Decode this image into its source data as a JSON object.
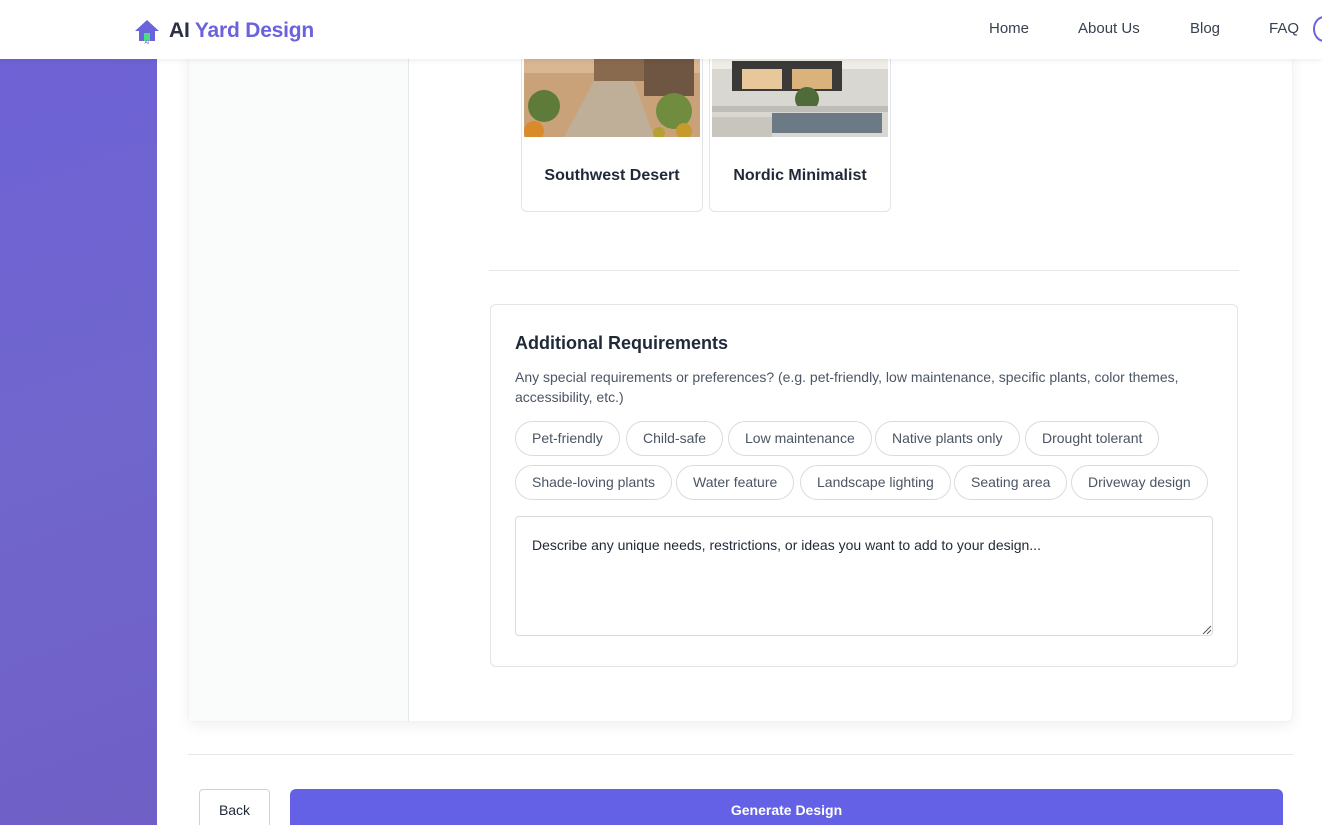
{
  "header": {
    "logo_ai": "AI",
    "logo_rest": "Yard Design",
    "nav": {
      "home": "Home",
      "about": "About Us",
      "blog": "Blog",
      "faq": "FAQ"
    }
  },
  "styles": [
    {
      "label": "Southwest Desert"
    },
    {
      "label": "Nordic Minimalist"
    }
  ],
  "requirements": {
    "title": "Additional Requirements",
    "description": "Any special requirements or preferences? (e.g. pet-friendly, low maintenance, specific plants, color themes, accessibility, etc.)",
    "chips": [
      "Pet-friendly",
      "Child-safe",
      "Low maintenance",
      "Native plants only",
      "Drought tolerant",
      "Shade-loving plants",
      "Water feature",
      "Landscape lighting",
      "Seating area",
      "Driveway design"
    ],
    "textarea_placeholder": "Describe any unique needs, restrictions, or ideas you want to add to your design..."
  },
  "actions": {
    "back": "Back",
    "generate": "Generate Design"
  },
  "colors": {
    "accent": "#6461e6",
    "brand": "#6b63dc"
  }
}
